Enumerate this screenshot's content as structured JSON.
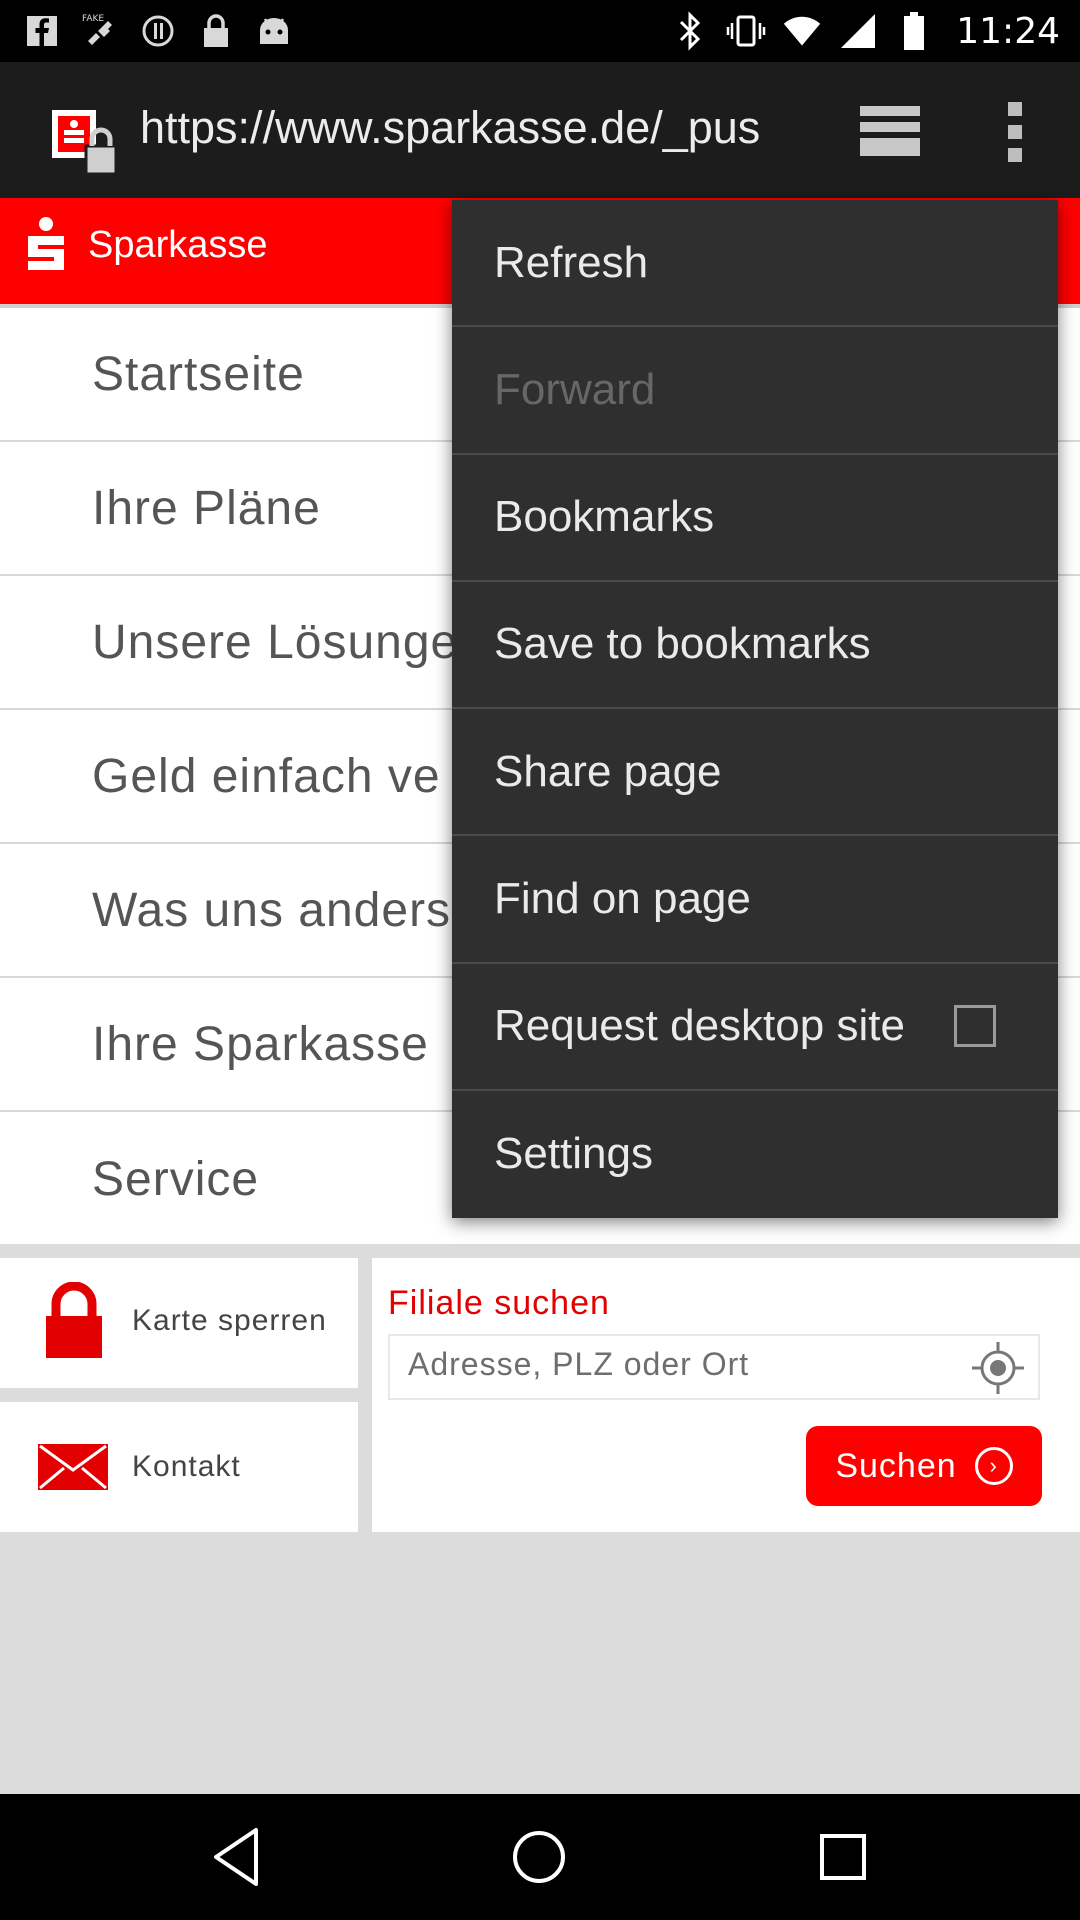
{
  "status_bar": {
    "time": "11:24",
    "left_icons": [
      "facebook-icon",
      "fake-gps-icon",
      "sync-icon",
      "lock-icon",
      "android-icon"
    ],
    "right_icons": [
      "bluetooth-icon",
      "vibrate-icon",
      "wifi-icon",
      "signal-icon",
      "battery-icon"
    ]
  },
  "browser": {
    "url": "https://www.sparkasse.de/_pus"
  },
  "site": {
    "brand": "Sparkasse",
    "nav_items": [
      {
        "label": "Startseite"
      },
      {
        "label": "Ihre Pläne"
      },
      {
        "label": "Unsere Lösunge"
      },
      {
        "label": "Geld einfach ve"
      },
      {
        "label": "Was uns anders"
      },
      {
        "label": "Ihre Sparkasse"
      },
      {
        "label": "Service"
      }
    ],
    "widgets": {
      "karte_sperren": "Karte sperren",
      "kontakt": "Kontakt",
      "filiale_title": "Filiale suchen",
      "search_placeholder": "Adresse, PLZ oder Ort",
      "suchen_label": "Suchen"
    },
    "accent_color": "#ff0000"
  },
  "menu": {
    "items": [
      {
        "label": "Refresh",
        "enabled": true
      },
      {
        "label": "Forward",
        "enabled": false
      },
      {
        "label": "Bookmarks",
        "enabled": true
      },
      {
        "label": "Save to bookmarks",
        "enabled": true
      },
      {
        "label": "Share page",
        "enabled": true
      },
      {
        "label": "Find on page",
        "enabled": true
      },
      {
        "label": "Request desktop site",
        "enabled": true,
        "checked": false
      },
      {
        "label": "Settings",
        "enabled": true
      }
    ]
  }
}
